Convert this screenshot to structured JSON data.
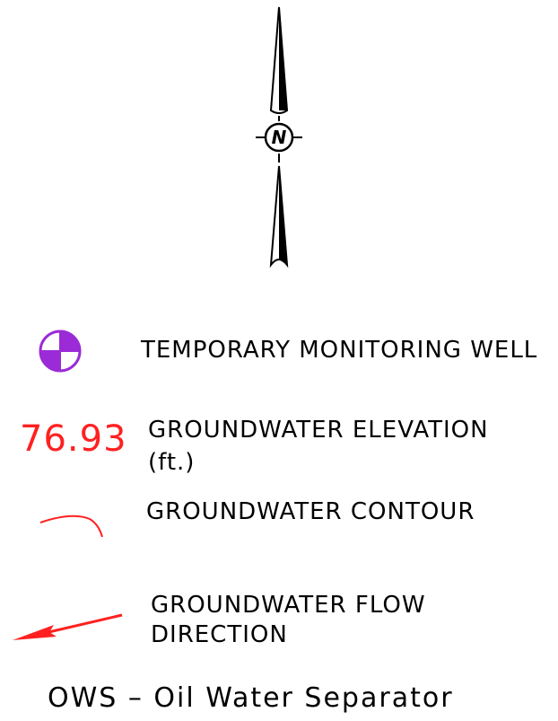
{
  "north_arrow": {
    "letter": "N",
    "icon": "north-arrow-icon"
  },
  "legend": {
    "well": {
      "label": "TEMPORARY MONITORING WELL",
      "icon": "monitoring-well-icon",
      "color": "#9a2bd6"
    },
    "elevation": {
      "value": "76.93",
      "label_line1": "GROUNDWATER ELEVATION",
      "label_line2": "(ft.)",
      "color": "#ff2020"
    },
    "contour": {
      "label": "GROUNDWATER CONTOUR",
      "icon": "contour-line-icon",
      "color": "#ff2020"
    },
    "flow": {
      "label_line1": "GROUNDWATER FLOW",
      "label_line2": "DIRECTION",
      "icon": "flow-arrow-icon",
      "color": "#ff2020"
    }
  },
  "abbreviation": {
    "text": "OWS – Oil Water Separator"
  }
}
